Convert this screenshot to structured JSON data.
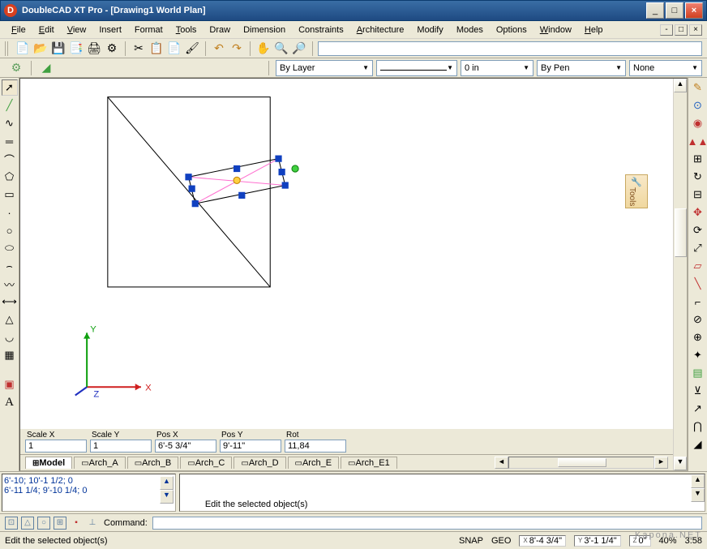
{
  "app": {
    "title": "DoubleCAD XT Pro - [Drawing1 World Plan]",
    "icon_letter": "D"
  },
  "menu": [
    "File",
    "Edit",
    "View",
    "Insert",
    "Format",
    "Tools",
    "Draw",
    "Dimension",
    "Constraints",
    "Architecture",
    "Modify",
    "Modes",
    "Options",
    "Window",
    "Help"
  ],
  "props": {
    "layer": "By Layer",
    "linewt": "0 in",
    "penstyle": "By Pen",
    "fill": "None"
  },
  "params": {
    "scalex_label": "Scale X",
    "scalex": "1",
    "scaley_label": "Scale Y",
    "scaley": "1",
    "posx_label": "Pos X",
    "posx": "6'-5 3/4\"",
    "posy_label": "Pos Y",
    "posy": "9'-11\"",
    "rot_label": "Rot",
    "rot": "11,84"
  },
  "tabs": [
    "Model",
    "Arch_A",
    "Arch_B",
    "Arch_C",
    "Arch_D",
    "Arch_E",
    "Arch_E1"
  ],
  "history": [
    "6'-10; 10'-1 1/2; 0",
    "6'-11 1/4; 9'-10 1/4; 0"
  ],
  "cmdout": "Edit the selected object(s)\n  or specify [ScaleX/ScaleY/PosX/PosY/Rot]\n  or choose [Toggle2D3D/EditTool/Move/Rotate/Scale/EditReferencePoin",
  "cmdline": {
    "label": "Command:",
    "value": ""
  },
  "status": {
    "hint": "Edit the selected object(s)",
    "snap": "SNAP",
    "geo": "GEO",
    "x": "8'-4 3/4\"",
    "y": "3'-1 1/4\"",
    "z": "0\"",
    "zoom": "40%",
    "time": "3:58"
  },
  "watermark": "Kapona.NET",
  "axes": {
    "x": "X",
    "y": "Y",
    "z": "Z"
  },
  "tools_label": "Tools"
}
